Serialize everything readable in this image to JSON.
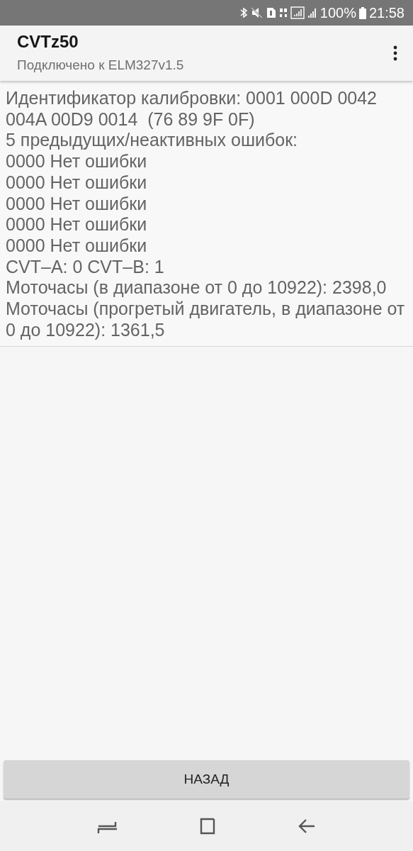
{
  "status_bar": {
    "battery_text": "100%",
    "time": "21:58"
  },
  "app_bar": {
    "title": "CVTz50",
    "subtitle": "Подключено к ELM327v1.5"
  },
  "report_lines": [
    "Идентификатор калибровки: 0001 000D 0042 004A 00D9 0014  (76 89 9F 0F)",
    "5 предыдущих/неактивных ошибок:",
    "0000 Нет ошибки",
    "0000 Нет ошибки",
    "0000 Нет ошибки",
    "0000 Нет ошибки",
    "0000 Нет ошибки",
    "CVT–A: 0 CVT–B: 1",
    "Моточасы (в диапазоне от 0 до 10922): 2398,0",
    "Моточасы (прогретый двигатель, в диапазоне от 0 до 10922): 1361,5"
  ],
  "back_button": {
    "label": "НАЗАД"
  }
}
